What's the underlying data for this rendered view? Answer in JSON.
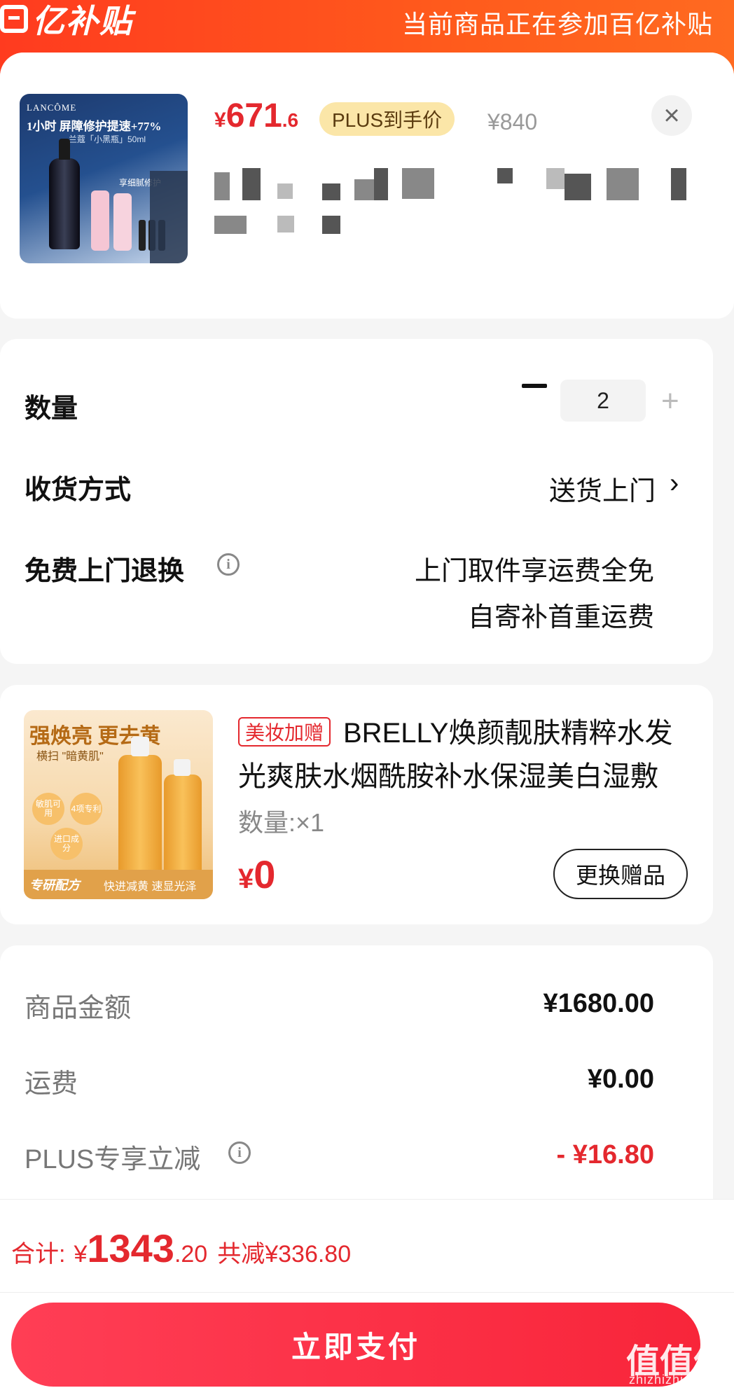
{
  "header": {
    "brand": "亿补贴",
    "notice": "当前商品正在参加百亿补贴"
  },
  "product": {
    "thumb_brand": "LANCÔME",
    "thumb_headline": "1小时 屏障修护提速+77%",
    "thumb_sub": "兰蔻「小黑瓶」50ml",
    "thumb_note": "享细腻修护",
    "price_symbol": "¥",
    "price_int": "671",
    "price_dec": ".6",
    "plus_tag": "PLUS到手价",
    "original_price": "¥840",
    "close_icon": "×"
  },
  "options": {
    "quantity_label": "数量",
    "quantity_value": "2",
    "quantity_plus": "+",
    "delivery_label": "收货方式",
    "delivery_value": "送货上门",
    "delivery_chevron": "›",
    "return_label": "免费上门退换",
    "return_line1": "上门取件享运费全免",
    "return_line2": "自寄补首重运费",
    "info_icon": "i"
  },
  "gift": {
    "thumb_headline": "强焕亮 更去黄",
    "thumb_sub": "横扫 \"暗黄肌\"",
    "thumb_badges": [
      "敏肌可用",
      "4项专利",
      "进口成分"
    ],
    "thumb_band_left": "专研配方",
    "thumb_band_right": "快进减黄 速显光泽",
    "tag": "美妆加赠",
    "title": "BRELLY焕颜靓肤精粹水发光爽肤水烟酰胺补水保湿美白湿敷",
    "quantity": "数量:×1",
    "price_symbol": "¥",
    "price_value": "0",
    "swap_button": "更换赠品"
  },
  "summary": {
    "goods_label": "商品金额",
    "goods_value": "¥1680.00",
    "shipping_label": "运费",
    "shipping_value": "¥0.00",
    "plus_label": "PLUS专享立减",
    "plus_value": "- ¥16.80"
  },
  "footer": {
    "total_label": "合计:",
    "total_symbol": "¥",
    "total_int": "1343",
    "total_dec": ".20",
    "total_saved": "共减¥336.80",
    "pay_button": "立即支付",
    "watermark": "值值值",
    "watermark_url": "zhizhizhi.com"
  },
  "colors": {
    "brand_orange": "#ff4a1c",
    "price_red": "#e4282e",
    "plus_gold": "#fbe6a8",
    "pay_red": "#f8253a"
  }
}
